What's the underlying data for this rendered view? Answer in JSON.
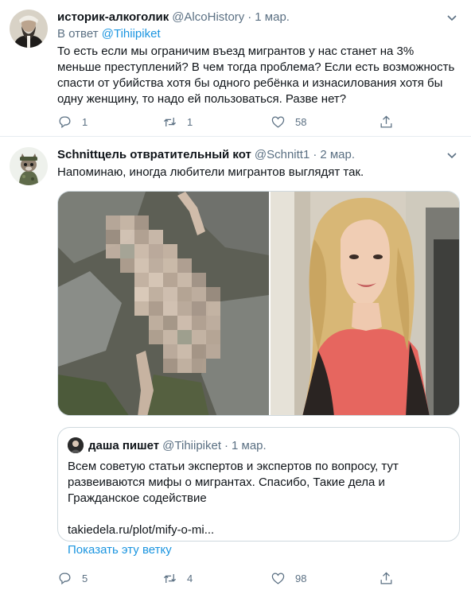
{
  "tweets": [
    {
      "author_name": "историк-алкоголик",
      "author_handle": "@AlcoHistory",
      "date": "1 мар.",
      "reply_prefix": "В ответ",
      "reply_handle": "@Tihiipiket",
      "text": "То есть если мы ограничим въезд мигрантов у нас станет на 3% меньше преступлений? В чем тогда проблема? Если есть возможность спасти от убийства хотя бы одного ребёнка и изнасилования хотя бы одну женщину, то надо ей пользоваться. Разве нет?",
      "replies": "1",
      "retweets": "1",
      "likes": "58"
    },
    {
      "author_name": "Schnittцель отвратительный кот",
      "author_handle": "@Schnitt1",
      "date": "2 мар.",
      "text": "Напоминаю, иногда любители мигрантов выглядят так.",
      "replies": "5",
      "retweets": "4",
      "likes": "98",
      "quote": {
        "author_name": "даша пишет",
        "author_handle": "@Tihiipiket",
        "date": "1 мар.",
        "text": "Всем советую статьи экспертов и экспертов по вопросу, тут развеиваются мифы о мигрантах. Спасибо, Такие дела и Гражданское содействие",
        "link": "takiedela.ru/plot/mify-o-mi...",
        "show_thread": "Показать эту ветку"
      }
    }
  ],
  "separator": "·",
  "icons": {
    "reply": "reply-icon",
    "retweet": "retweet-icon",
    "like": "heart-icon",
    "share": "share-icon",
    "more": "more-icon"
  },
  "colors": {
    "link": "#1b95e0",
    "secondary_text": "#5b7083",
    "border": "#e6ecf0"
  }
}
